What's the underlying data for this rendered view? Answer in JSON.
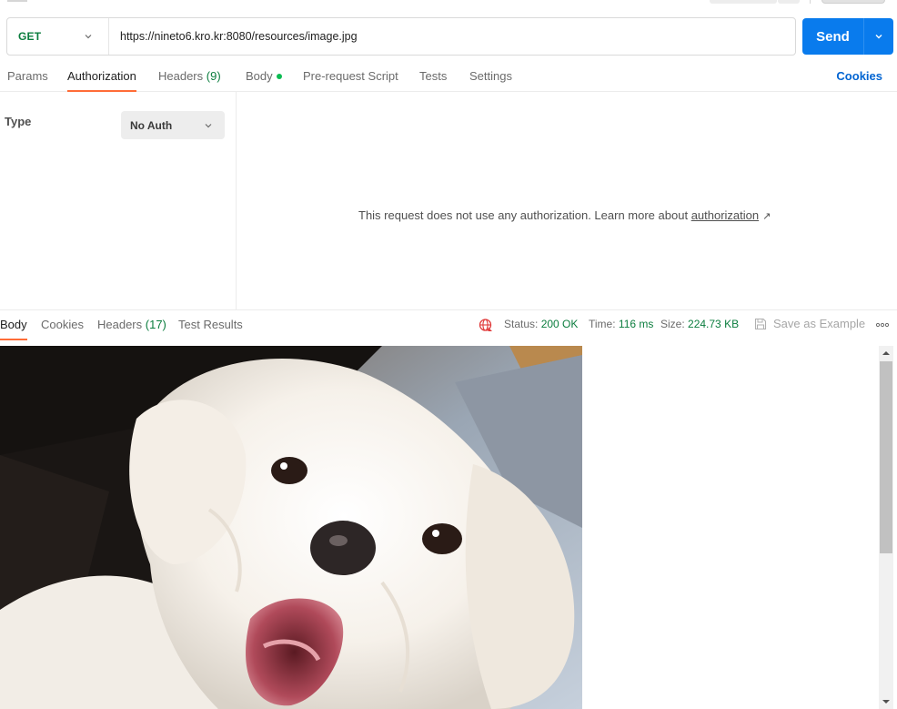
{
  "request": {
    "method": "GET",
    "url": "https://nineto6.kro.kr:8080/resources/image.jpg",
    "send_label": "Send"
  },
  "request_tabs": {
    "params": "Params",
    "authorization": "Authorization",
    "headers": "Headers",
    "headers_count": "(9)",
    "body": "Body",
    "pre_request": "Pre-request Script",
    "tests": "Tests",
    "settings": "Settings",
    "cookies": "Cookies",
    "active": "Authorization"
  },
  "auth": {
    "type_label": "Type",
    "type_value": "No Auth",
    "message": "This request does not use any authorization. Learn more about",
    "link_text": "authorization",
    "link_arrow": "↗"
  },
  "response": {
    "tabs": {
      "body": "Body",
      "cookies": "Cookies",
      "headers": "Headers",
      "headers_count": "(17)",
      "test_results": "Test Results",
      "active": "Body"
    },
    "status_label": "Status:",
    "status_value": "200 OK",
    "time_label": "Time:",
    "time_value": "116 ms",
    "size_label": "Size:",
    "size_value": "224.73 KB",
    "save_example": "Save as Example",
    "scroll_position": 0.0
  },
  "colors": {
    "accent_orange": "#ff6c37",
    "send_blue": "#097bed",
    "method_green": "#0b7d3e",
    "link_blue": "#0265d2"
  },
  "icons": {
    "method_dropdown": "chevron-down-icon",
    "send_dropdown": "chevron-down-icon",
    "auth_dropdown": "chevron-down-icon",
    "network": "globe-icon",
    "save": "save-icon",
    "more": "more-horizontal-icon"
  }
}
